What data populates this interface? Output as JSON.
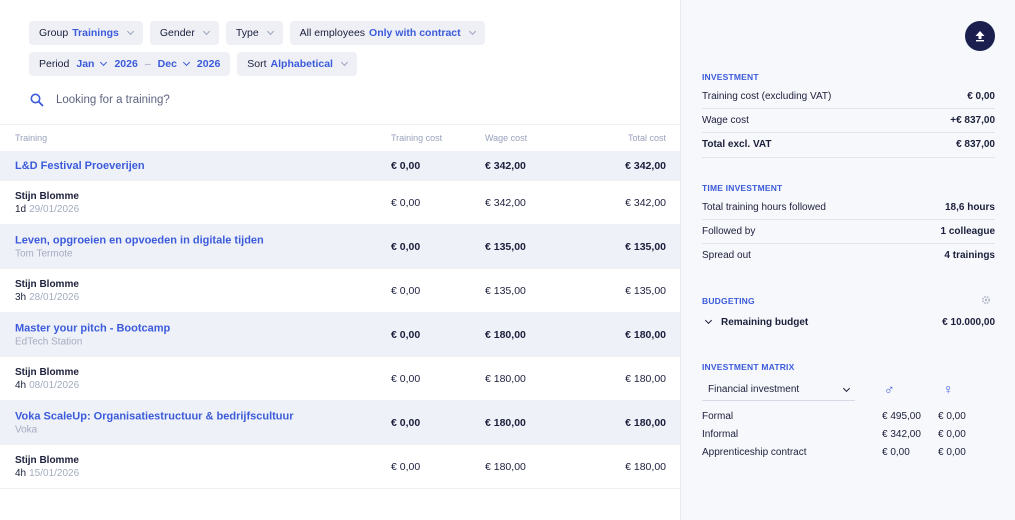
{
  "filters": {
    "group": {
      "label": "Group",
      "value": "Trainings"
    },
    "gender": {
      "label": "Gender"
    },
    "type": {
      "label": "Type"
    },
    "employees": {
      "label": "All employees",
      "value": "Only with contract"
    },
    "period": {
      "label": "Period",
      "from_month": "Jan",
      "from_year": "2026",
      "to_month": "Dec",
      "to_year": "2026"
    },
    "sort": {
      "label": "Sort",
      "value": "Alphabetical"
    }
  },
  "search": {
    "placeholder": "Looking for a training?"
  },
  "table": {
    "headers": {
      "name": "Training",
      "training_cost": "Training cost",
      "wage_cost": "Wage cost",
      "total_cost": "Total cost"
    },
    "groups": [
      {
        "title": "L&D Festival Proeverijen",
        "subtitle": "",
        "training_cost": "€ 0,00",
        "wage_cost": "€ 342,00",
        "total_cost": "€ 342,00",
        "rows": [
          {
            "name": "Stijn Blomme",
            "duration": "1d",
            "date": "29/01/2026",
            "training_cost": "€ 0,00",
            "wage_cost": "€ 342,00",
            "total_cost": "€ 342,00"
          }
        ]
      },
      {
        "title": "Leven, opgroeien en opvoeden in digitale tijden",
        "subtitle": "Tom Termote",
        "training_cost": "€ 0,00",
        "wage_cost": "€ 135,00",
        "total_cost": "€ 135,00",
        "rows": [
          {
            "name": "Stijn Blomme",
            "duration": "3h",
            "date": "28/01/2026",
            "training_cost": "€ 0,00",
            "wage_cost": "€ 135,00",
            "total_cost": "€ 135,00"
          }
        ]
      },
      {
        "title": "Master your pitch - Bootcamp",
        "subtitle": "EdTech Station",
        "training_cost": "€ 0,00",
        "wage_cost": "€ 180,00",
        "total_cost": "€ 180,00",
        "rows": [
          {
            "name": "Stijn Blomme",
            "duration": "4h",
            "date": "08/01/2026",
            "training_cost": "€ 0,00",
            "wage_cost": "€ 180,00",
            "total_cost": "€ 180,00"
          }
        ]
      },
      {
        "title": "Voka ScaleUp: Organisatiestructuur & bedrijfscultuur",
        "subtitle": "Voka",
        "training_cost": "€ 0,00",
        "wage_cost": "€ 180,00",
        "total_cost": "€ 180,00",
        "rows": [
          {
            "name": "Stijn Blomme",
            "duration": "4h",
            "date": "15/01/2026",
            "training_cost": "€ 0,00",
            "wage_cost": "€ 180,00",
            "total_cost": "€ 180,00"
          }
        ]
      }
    ]
  },
  "sidebar": {
    "investment": {
      "title": "INVESTMENT",
      "rows": [
        {
          "label": "Training cost (excluding VAT)",
          "value": "€ 0,00"
        },
        {
          "label": "Wage cost",
          "value": "+€ 837,00"
        }
      ],
      "total": {
        "label": "Total excl. VAT",
        "value": "€ 837,00"
      }
    },
    "time_investment": {
      "title": "TIME INVESTMENT",
      "rows": [
        {
          "label": "Total training hours followed",
          "value": "18,6 hours"
        },
        {
          "label": "Followed by",
          "value": "1 colleague"
        },
        {
          "label": "Spread out",
          "value": "4 trainings"
        }
      ]
    },
    "budgeting": {
      "title": "BUDGETING",
      "remaining": {
        "label": "Remaining budget",
        "value": "€ 10.000,00"
      }
    },
    "matrix": {
      "title": "INVESTMENT MATRIX",
      "select_value": "Financial investment",
      "male_symbol": "♂",
      "female_symbol": "♀",
      "rows": [
        {
          "label": "Formal",
          "male": "€ 495,00",
          "female": "€ 0,00"
        },
        {
          "label": "Informal",
          "male": "€ 342,00",
          "female": "€ 0,00"
        },
        {
          "label": "Apprenticeship contract",
          "male": "€ 0,00",
          "female": "€ 0,00"
        }
      ]
    }
  },
  "icons": {
    "search": "search-icon",
    "upload": "upload-icon",
    "gear": "gear-icon"
  },
  "colors": {
    "accent": "#3b5bdb",
    "dark": "#1b1f4d",
    "group_bg": "#eff1f8",
    "chip_bg": "#eef0f6"
  }
}
